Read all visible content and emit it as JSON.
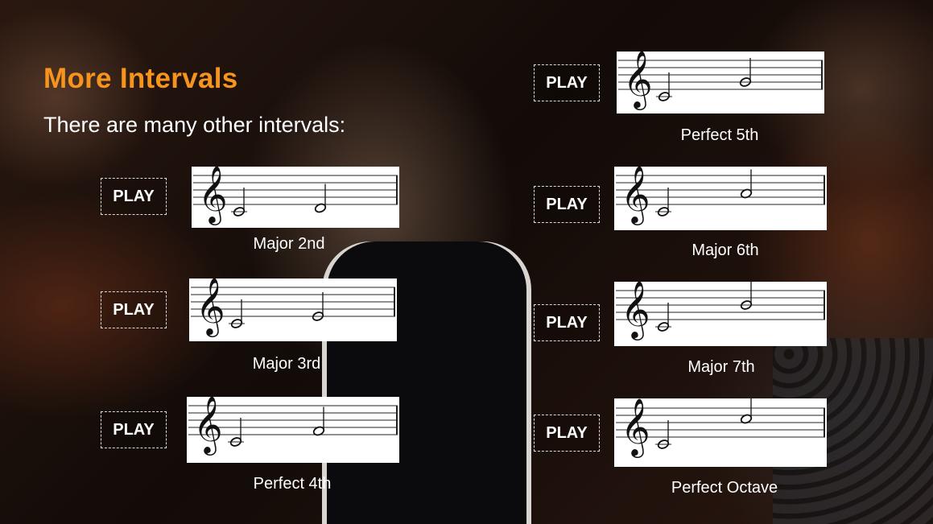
{
  "slide": {
    "title": "More Intervals",
    "subtitle": "There are many other intervals:",
    "accent_color": "#f7941d"
  },
  "intervals": [
    {
      "play_label": "PLAY",
      "name": "Major 2nd",
      "note1": "C4",
      "note2": "D4"
    },
    {
      "play_label": "PLAY",
      "name": "Major 3rd",
      "note1": "C4",
      "note2": "E4"
    },
    {
      "play_label": "PLAY",
      "name": "Perfect 4th",
      "note1": "C4",
      "note2": "F4"
    },
    {
      "play_label": "PLAY",
      "name": "Perfect 5th",
      "note1": "C4",
      "note2": "G4"
    },
    {
      "play_label": "PLAY",
      "name": "Major 6th",
      "note1": "C4",
      "note2": "A4"
    },
    {
      "play_label": "PLAY",
      "name": "Major 7th",
      "note1": "C4",
      "note2": "B4"
    },
    {
      "play_label": "PLAY",
      "name": "Perfect Octave",
      "note1": "C4",
      "note2": "C5"
    }
  ],
  "icons": {
    "clef": "treble-clef-icon",
    "note": "half-note-icon",
    "play": "play-button"
  }
}
